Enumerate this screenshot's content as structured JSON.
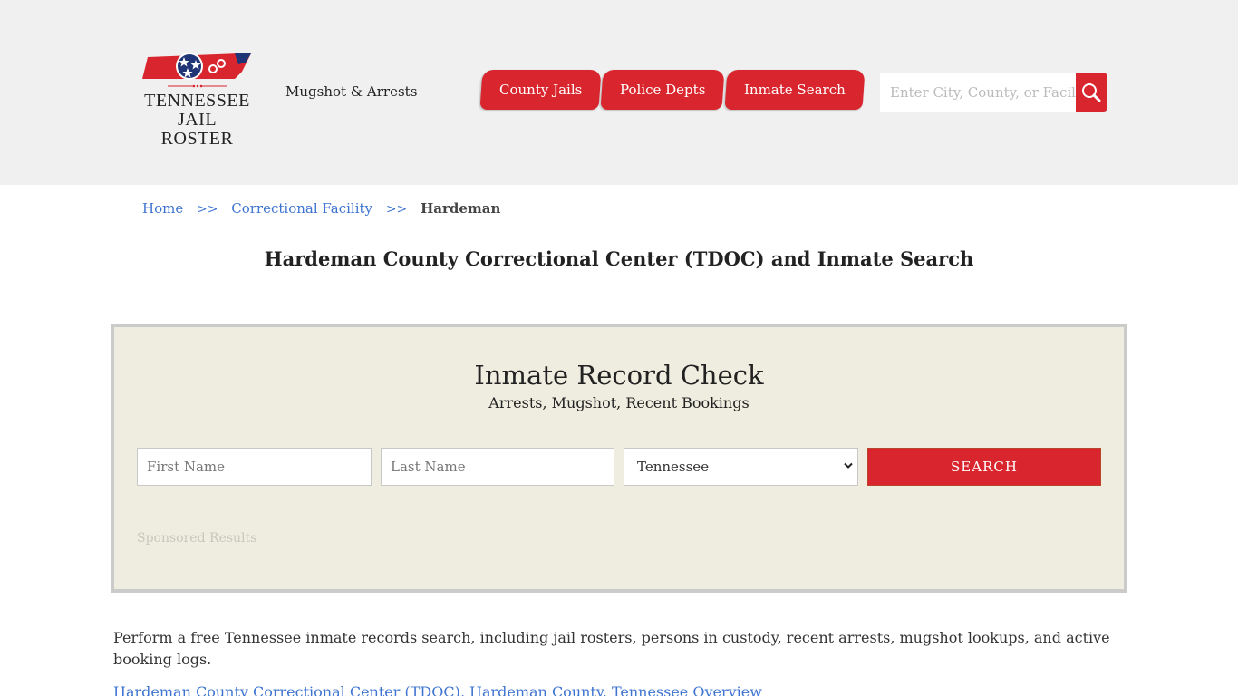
{
  "header": {
    "logo": {
      "line1": "TENNESSEE",
      "line2": "JAIL ROSTER",
      "icon": "tennessee-map-logo-icon"
    },
    "tagline": "Mugshot & Arrests",
    "nav": [
      {
        "label": "County Jails"
      },
      {
        "label": "Police Depts"
      },
      {
        "label": "Inmate Search"
      }
    ],
    "search": {
      "placeholder": "Enter City, County, or Facility",
      "icon": "search-icon"
    }
  },
  "breadcrumb": {
    "items": [
      {
        "label": "Home"
      },
      {
        "label": "Correctional Facility"
      }
    ],
    "separator": ">>",
    "current": "Hardeman"
  },
  "page_title": "Hardeman County Correctional Center (TDOC) and Inmate Search",
  "record_check": {
    "title": "Inmate Record Check",
    "subtitle": "Arrests, Mugshot, Recent Bookings",
    "first_name_placeholder": "First Name",
    "last_name_placeholder": "Last Name",
    "state_selected": "Tennessee",
    "search_label": "SEARCH",
    "sponsored_label": "Sponsored Results"
  },
  "content": {
    "intro": "Perform a free Tennessee inmate records search, including jail rosters, persons in custody, recent arrests, mugshot lookups, and active booking logs.",
    "overview_heading": "Hardeman County Correctional Center (TDOC), Hardeman County, Tennessee Overview"
  },
  "colors": {
    "brand_red": "#d9262e",
    "link_blue": "#3e74d0",
    "header_bg": "#f0f0f0",
    "panel_bg": "#efede0",
    "panel_border": "#cbcbcb"
  }
}
